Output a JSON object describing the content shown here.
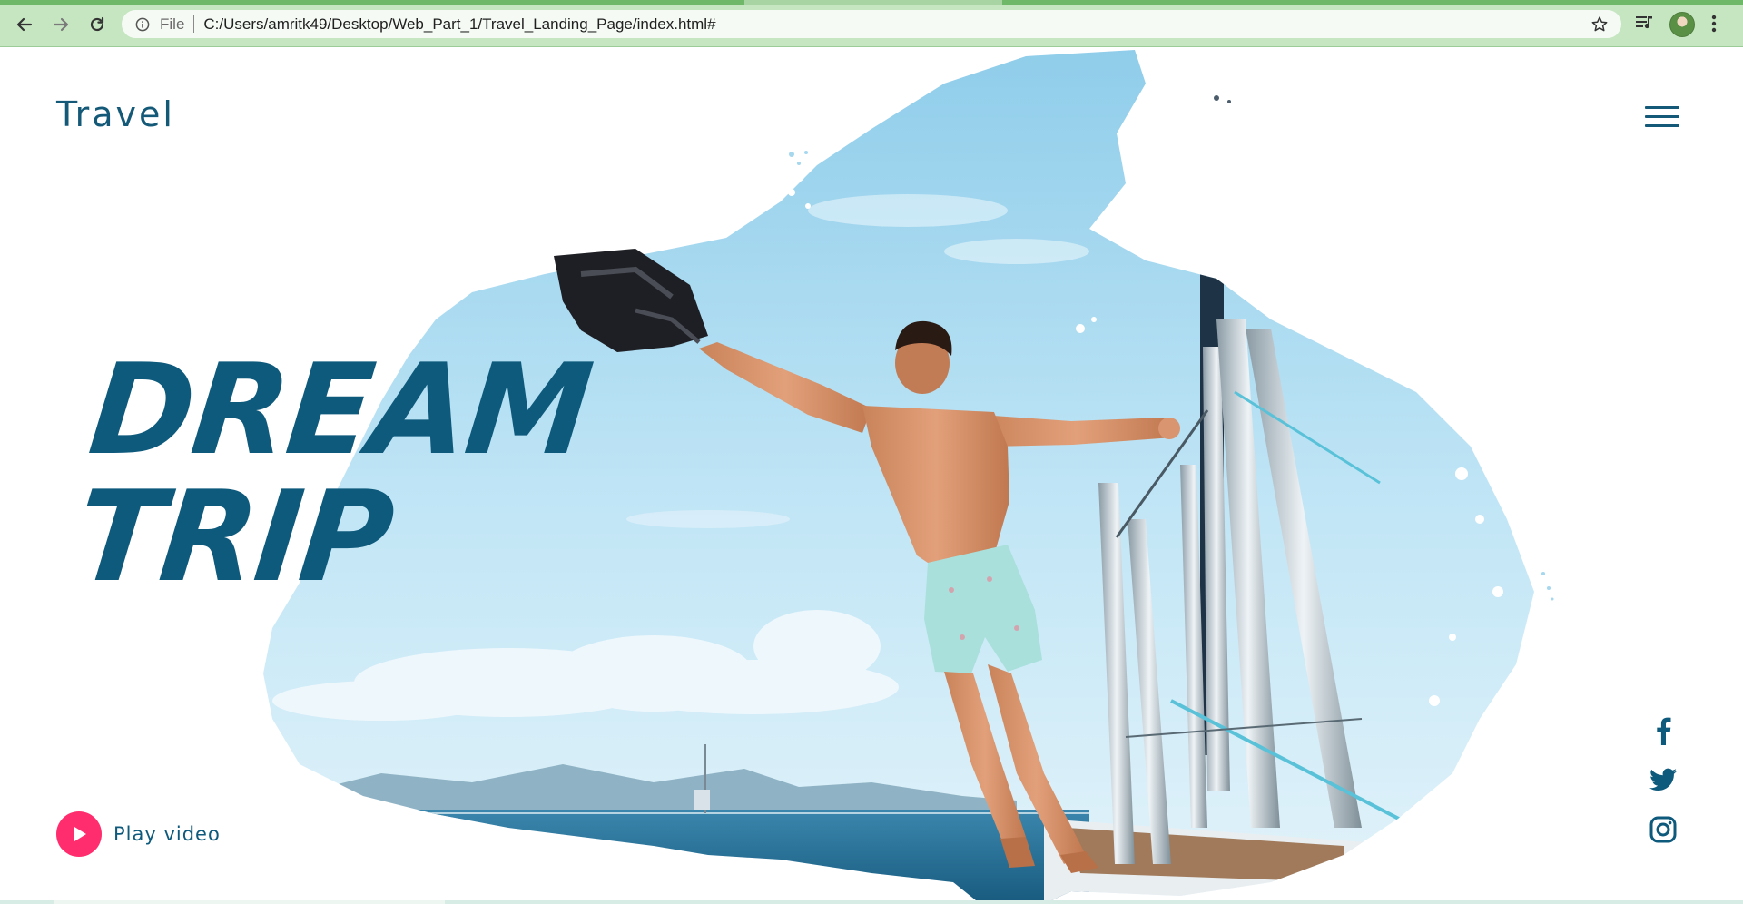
{
  "browser": {
    "scheme_label": "File",
    "url": "C:/Users/amritk49/Desktop/Web_Part_1/Travel_Landing_Page/index.html#"
  },
  "page": {
    "brand": "Travel",
    "headline": [
      "DREAM",
      "TRIP"
    ],
    "play_video_label": "Play video",
    "social_links": [
      {
        "name": "facebook",
        "icon": "facebook-icon"
      },
      {
        "name": "twitter",
        "icon": "twitter-icon"
      },
      {
        "name": "instagram",
        "icon": "instagram-icon"
      }
    ],
    "colors": {
      "brand_blue": "#0e5a7c",
      "accent_pink": "#ff2d6e",
      "sky": "#b7e0f4",
      "sea": "#1f6e96",
      "browser_chrome": "#c6e6c2"
    }
  }
}
